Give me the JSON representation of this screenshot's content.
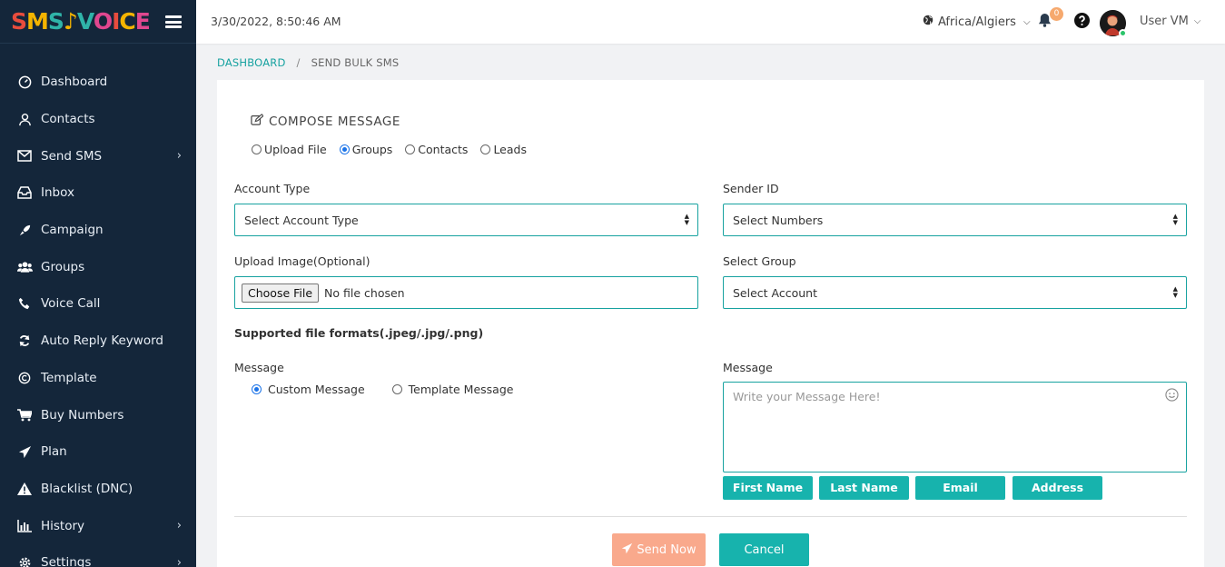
{
  "app": {
    "logo_part1": "SMS",
    "logo_part2": "VOICE"
  },
  "topbar": {
    "datetime": "3/30/2022, 8:50:46 AM",
    "timezone": "Africa/Algiers",
    "notification_count": "0",
    "username": "User VM"
  },
  "sidebar": {
    "items": [
      {
        "label": "Dashboard",
        "icon": "gauge-icon",
        "has_submenu": false
      },
      {
        "label": "Contacts",
        "icon": "user-icon",
        "has_submenu": false
      },
      {
        "label": "Send SMS",
        "icon": "envelope-icon",
        "has_submenu": true
      },
      {
        "label": "Inbox",
        "icon": "inbox-icon",
        "has_submenu": false
      },
      {
        "label": "Campaign",
        "icon": "rocket-icon",
        "has_submenu": false
      },
      {
        "label": "Groups",
        "icon": "users-icon",
        "has_submenu": false
      },
      {
        "label": "Voice Call",
        "icon": "phone-icon",
        "has_submenu": false
      },
      {
        "label": "Auto Reply Keyword",
        "icon": "refresh-icon",
        "has_submenu": false
      },
      {
        "label": "Template",
        "icon": "copyright-icon",
        "has_submenu": false
      },
      {
        "label": "Buy Numbers",
        "icon": "cart-icon",
        "has_submenu": false
      },
      {
        "label": "Plan",
        "icon": "paper-plane-icon",
        "has_submenu": false
      },
      {
        "label": "Blacklist (DNC)",
        "icon": "warning-icon",
        "has_submenu": false
      },
      {
        "label": "History",
        "icon": "bar-chart-icon",
        "has_submenu": true
      },
      {
        "label": "Settings",
        "icon": "gear-icon",
        "has_submenu": true
      }
    ]
  },
  "breadcrumb": {
    "home": "DASHBOARD",
    "separator": "/",
    "current": "SEND BULK SMS"
  },
  "form": {
    "title": "COMPOSE MESSAGE",
    "source_options": [
      {
        "label": "Upload File",
        "checked": false
      },
      {
        "label": "Groups",
        "checked": true
      },
      {
        "label": "Contacts",
        "checked": false
      },
      {
        "label": "Leads",
        "checked": false
      }
    ],
    "account_type_label": "Account Type",
    "account_type_value": "Select Account Type",
    "sender_id_label": "Sender ID",
    "sender_id_value": "Select Numbers",
    "upload_image_label": "Upload Image(Optional)",
    "choose_file_label": "Choose File",
    "no_file_text": "No file chosen",
    "select_group_label": "Select Group",
    "select_group_value": "Select Account",
    "supported_formats": "Supported file formats(.jpeg/.jpg/.png)",
    "message_type_label": "Message",
    "message_type_options": [
      {
        "label": "Custom Message",
        "checked": true
      },
      {
        "label": "Template Message",
        "checked": false
      }
    ],
    "message_label": "Message",
    "message_placeholder": "Write your Message Here!",
    "tag_buttons": [
      "First Name",
      "Last Name",
      "Email",
      "Address"
    ],
    "send_label": "Send Now",
    "cancel_label": "Cancel"
  },
  "colors": {
    "sidebar_bg": "#14263a",
    "accent_teal": "#17b3ad",
    "send_button": "#f9a98c",
    "badge": "#f6a96e"
  }
}
